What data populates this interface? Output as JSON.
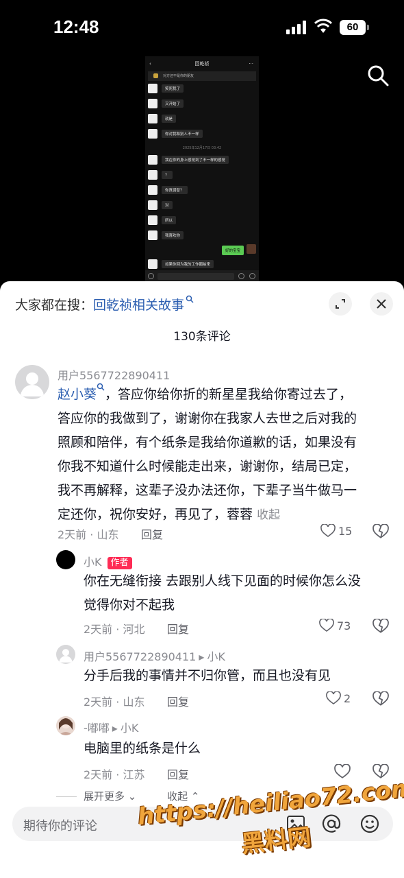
{
  "status_bar": {
    "time": "12:48",
    "battery": "60"
  },
  "chat_screenshot": {
    "title": "回乾祯",
    "notice": "对方还不是你的朋友",
    "messages": [
      "笑死我了",
      "又开始了",
      "就是",
      "你对我和别人不一样"
    ],
    "timestamp": "2025年12月17日 03:42",
    "messages2": [
      "我在你的身上感觉到了不一样的感觉",
      "？",
      "你真弱智？",
      "对",
      "所以",
      "我喜欢你"
    ],
    "my_message": "好的宝宝",
    "last_message": "如果你回为我的工作圈拍来"
  },
  "sheet": {
    "search_prefix": "大家都在搜：",
    "search_keyword": "回乾祯相关故事",
    "comment_count": "130条评论"
  },
  "comments": [
    {
      "user": "用户5567722890411",
      "mention": "赵小葵",
      "text_lines": [
        "，答应你给你折的新星星我给你寄过去了，",
        "答应你的我做到了，谢谢你在我家人去世之后对我的",
        "照顾和陪伴，有个纸条是我给你道歉的话，如果没有",
        "你我不知道什么时候能走出来，谢谢你，结局已定，",
        "我不再解释，这辈子没办法还你，下辈子当牛做马一",
        "定还你，祝你安好，再见了，蓉蓉"
      ],
      "collapse": "收起",
      "meta": "2天前 · 山东",
      "reply": "回复",
      "likes": "15"
    },
    {
      "user": "小K",
      "tag": "作者",
      "text_lines": [
        "你在无缝衔接 去跟别人线下见面的时候你怎么没",
        "觉得你对不起我"
      ],
      "meta": "2天前 · 河北",
      "reply": "回复",
      "likes": "73"
    },
    {
      "user": "用户5567722890411",
      "reply_to": "小K",
      "text": "分手后我的事情并不归你管，而且也没有见",
      "meta": "2天前 · 山东",
      "reply": "回复",
      "likes": "2"
    },
    {
      "user": "-嘟嘟",
      "reply_to": "小K",
      "text": "电脑里的纸条是什么",
      "meta": "2天前 · 江苏",
      "reply": "回复"
    }
  ],
  "expand": {
    "more": "展开更多",
    "collapse": "收起"
  },
  "input": {
    "placeholder": "期待你的评论"
  },
  "watermark": {
    "url": "https://heiliao72.com",
    "name": "黑料网"
  }
}
